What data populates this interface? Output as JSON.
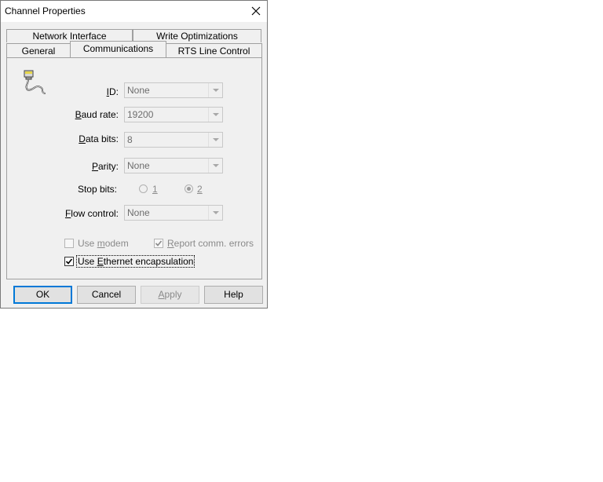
{
  "window": {
    "title": "Channel Properties"
  },
  "tabs": {
    "row_back": [
      {
        "label": "Network Interface"
      },
      {
        "label": "Write Optimizations"
      }
    ],
    "row_front": [
      {
        "label": "General"
      },
      {
        "label": "Communications"
      },
      {
        "label": "RTS Line Control"
      }
    ],
    "active": "Communications"
  },
  "form": {
    "id": {
      "label_u": "I",
      "label_rest": "D:",
      "value": "None"
    },
    "baud": {
      "label_pre": "",
      "label_u": "B",
      "label_rest": "aud rate:",
      "value": "19200"
    },
    "databits": {
      "label_u": "D",
      "label_rest": "ata bits:",
      "value": "8"
    },
    "parity": {
      "label_u": "P",
      "label_rest": "arity:",
      "value": "None"
    },
    "stopbits": {
      "label": "Stop bits:",
      "option1": "1",
      "option2": "2",
      "selected": "2"
    },
    "flow": {
      "label_u": "F",
      "label_rest": "low control:",
      "value": "None"
    }
  },
  "checks": {
    "use_modem": {
      "label_pre": "Use ",
      "label_u": "m",
      "label_rest": "odem",
      "checked": false
    },
    "report_errors": {
      "label_u": "R",
      "label_rest": "eport comm. errors",
      "checked": true
    },
    "ethernet": {
      "label_pre": "Use ",
      "label_u": "E",
      "label_rest": "thernet encapsulation",
      "checked": true
    }
  },
  "buttons": {
    "ok": "OK",
    "cancel": "Cancel",
    "apply_u": "A",
    "apply_rest": "pply",
    "help": "Help"
  }
}
